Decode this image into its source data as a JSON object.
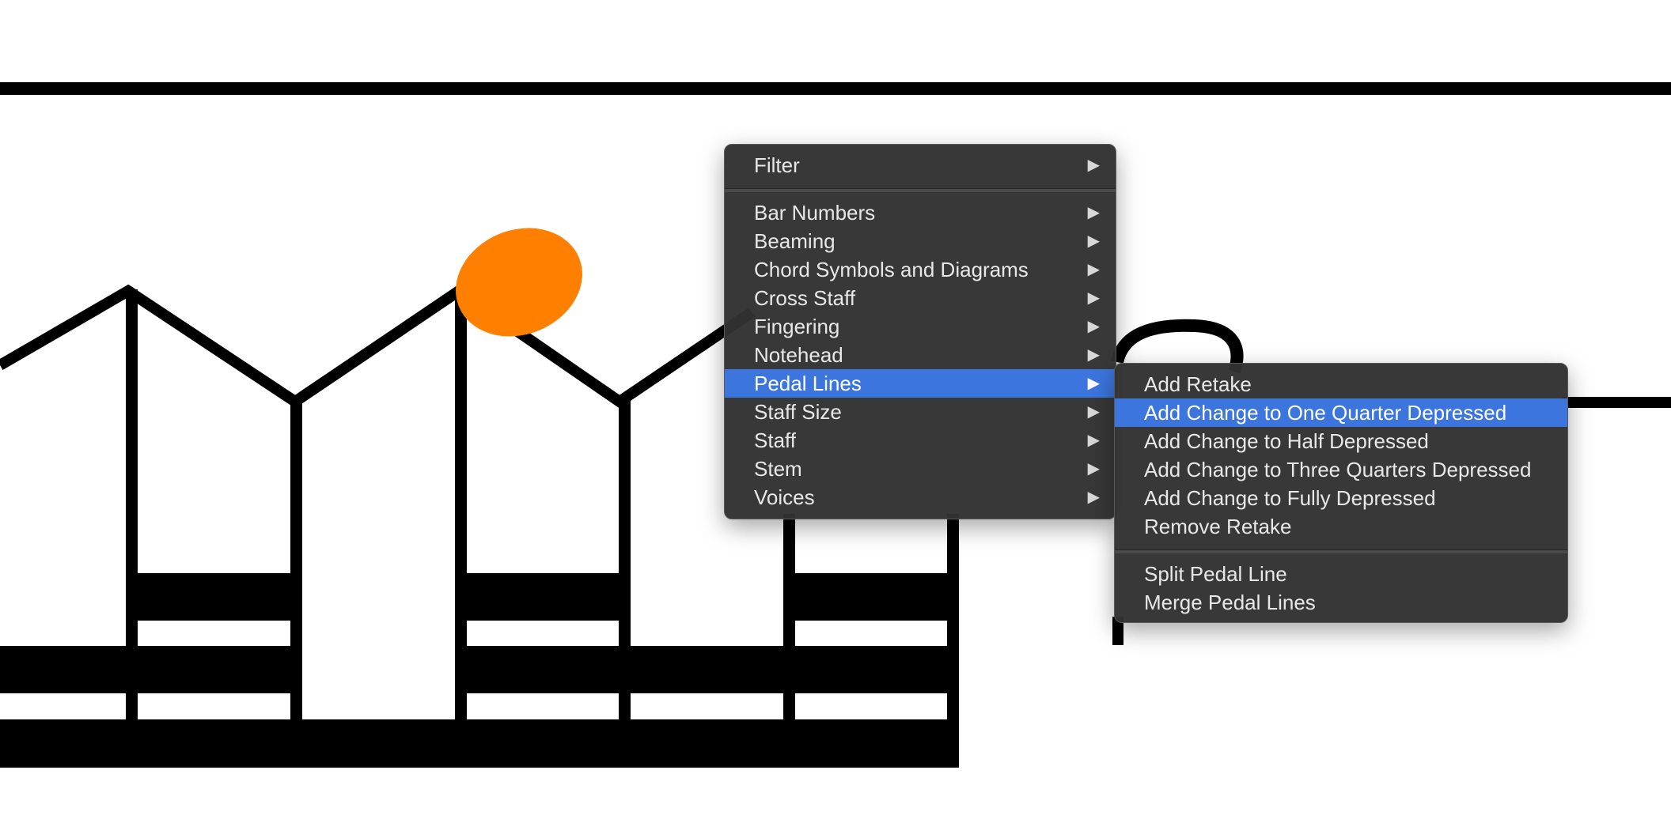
{
  "colors": {
    "notehead_selected": "#FF7F00",
    "menu_background": "#323232",
    "menu_highlight": "#3B75DD",
    "menu_text": "#E8E8E8"
  },
  "context_menu": {
    "items": [
      {
        "label": "Filter",
        "submenu_icon": "triangle-right-icon",
        "arrow": "▶"
      },
      {
        "separator": true
      },
      {
        "label": "Bar Numbers",
        "arrow": "▶"
      },
      {
        "label": "Beaming",
        "arrow": "▶"
      },
      {
        "label": "Chord Symbols and Diagrams",
        "arrow": "▶"
      },
      {
        "label": "Cross Staff",
        "arrow": "▶"
      },
      {
        "label": "Fingering",
        "arrow": "▶"
      },
      {
        "label": "Notehead",
        "arrow": "▶"
      },
      {
        "label": "Pedal Lines",
        "arrow": "▶",
        "highlighted": true
      },
      {
        "label": "Staff Size",
        "arrow": "▶"
      },
      {
        "label": "Staff",
        "arrow": "▶"
      },
      {
        "label": "Stem",
        "arrow": "▶"
      },
      {
        "label": "Voices",
        "arrow": "▶"
      }
    ]
  },
  "pedal_lines_submenu": {
    "items": [
      {
        "label": "Add Retake"
      },
      {
        "label": "Add Change to One Quarter Depressed",
        "highlighted": true
      },
      {
        "label": "Add Change to Half Depressed"
      },
      {
        "label": "Add Change to Three Quarters Depressed"
      },
      {
        "label": "Add Change to Fully Depressed"
      },
      {
        "label": "Remove Retake"
      },
      {
        "separator": true
      },
      {
        "label": "Split Pedal Line"
      },
      {
        "label": "Merge Pedal Lines"
      }
    ]
  }
}
